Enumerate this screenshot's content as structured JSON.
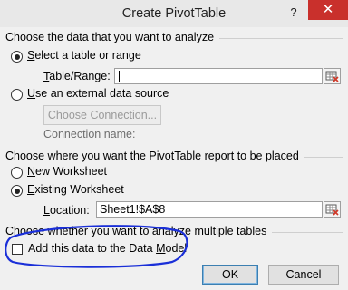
{
  "window": {
    "title": "Create PivotTable",
    "help_glyph": "?",
    "close_glyph": "✕"
  },
  "section1": {
    "label": "Choose the data that you want to analyze",
    "option_table": "Select a table or range",
    "table_range_label": "Table/Range:",
    "table_range_value": "",
    "option_external": "Use an external data source",
    "choose_connection": "Choose Connection...",
    "connection_name_label": "Connection name:"
  },
  "section2": {
    "label": "Choose where you want the PivotTable report to be placed",
    "option_new": "New Worksheet",
    "option_existing": "Existing Worksheet",
    "location_label": "Location:",
    "location_value": "Sheet1!$A$8"
  },
  "section3": {
    "label": "Choose whether you want to analyze multiple tables",
    "add_data_model": "Add this data to the Data Model"
  },
  "buttons": {
    "ok": "OK",
    "cancel": "Cancel"
  },
  "annotation": {
    "color": "#1a2fd8"
  }
}
